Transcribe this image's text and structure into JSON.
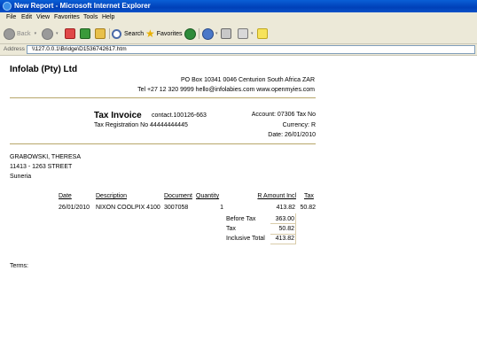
{
  "window": {
    "title": "New Report - Microsoft Internet Explorer"
  },
  "menu": [
    "File",
    "Edit",
    "View",
    "Favorites",
    "Tools",
    "Help"
  ],
  "toolbar": {
    "back_label": "Back",
    "search_label": "Search",
    "favorites_label": "Favorites"
  },
  "address": {
    "label": "Address",
    "url": "\\\\127.0.0.1\\Bridge\\D1536742617.htm"
  },
  "company": {
    "name": "Infolab (Pty) Ltd",
    "address": "PO Box 10341 0046 Centurion South Africa ZAR",
    "contact": "Tel +27 12 320 9999 hello@infolabies.com www.openmyies.com"
  },
  "invoice": {
    "title": "Tax Invoice",
    "contact_ref": "contact.100126-663",
    "tax_reg": "Tax Registration No 44444444445",
    "account": "Account: 07306 Tax No",
    "currency": "Currency: R",
    "date": "Date: 26/01/2010"
  },
  "customer": {
    "name": "GRABOWSKI, THERESA",
    "street": "11413 - 1263 STREET",
    "suburb": "Suneria"
  },
  "table": {
    "headers": {
      "date": "Date",
      "description": "Description",
      "document": "Document",
      "quantity": "Quantity",
      "amount": "R Amount Incl",
      "tax": "Tax"
    },
    "rows": [
      {
        "date": "26/01/2010",
        "description": "NIXON COOLPIX 4100",
        "document": "3007058",
        "quantity": "1",
        "amount": "413.82",
        "tax": "50.82"
      }
    ]
  },
  "totals": {
    "before_tax_label": "Before Tax",
    "before_tax": "363.00",
    "tax_label": "Tax",
    "tax": "50.82",
    "inclusive_label": "Inclusive Total",
    "inclusive": "413.82"
  },
  "terms_label": "Terms:"
}
